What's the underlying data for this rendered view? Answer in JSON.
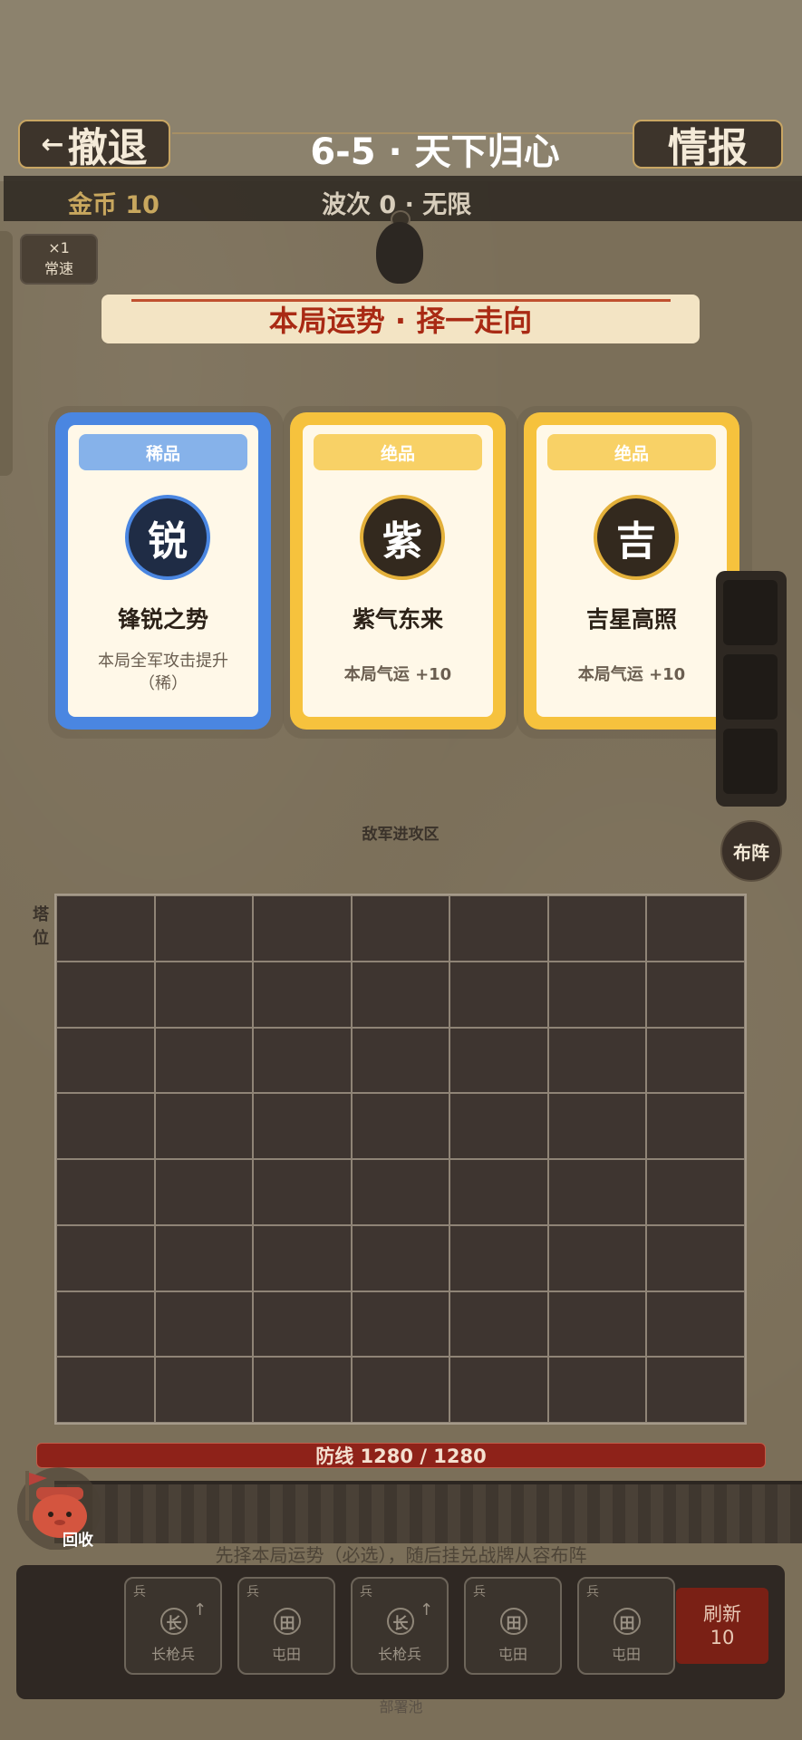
{
  "header": {
    "retreat_label": "撤退",
    "retreat_icon": "←",
    "title": "6-5 · 天下归心",
    "intel_label": "情报"
  },
  "status": {
    "gold": "金币 10",
    "wave": "波次 0 · 无限"
  },
  "speed": {
    "multiplier": "×1",
    "label": "常速"
  },
  "fortune": {
    "banner": "本局运势 · 择一走向",
    "cards": [
      {
        "rarity": "稀品",
        "emblem": "锐",
        "name": "锋锐之势",
        "desc": "本局全军攻击提升（稀）"
      },
      {
        "rarity": "绝品",
        "emblem": "紫",
        "name": "紫气东来",
        "desc": "本局气运 +10"
      },
      {
        "rarity": "绝品",
        "emblem": "吉",
        "name": "吉星高照",
        "desc": "本局气运 +10"
      }
    ]
  },
  "battlefield": {
    "enemy_zone": "敌军进攻区",
    "tower_label": "塔位",
    "deploy_label": "布阵",
    "defense": "防线 1280 / 1280",
    "defense_fraction": 1.0
  },
  "bottom": {
    "recycle_label": "回收",
    "hint": "先择本局运势（必选），随后挂兑战牌从容布阵",
    "hand": [
      {
        "kind": "兵",
        "icon": "长",
        "name": "长枪兵",
        "arrow": true
      },
      {
        "kind": "兵",
        "icon": "田",
        "name": "屯田",
        "arrow": false
      },
      {
        "kind": "兵",
        "icon": "长",
        "name": "长枪兵",
        "arrow": true
      },
      {
        "kind": "兵",
        "icon": "田",
        "name": "屯田",
        "arrow": false
      },
      {
        "kind": "兵",
        "icon": "田",
        "name": "屯田",
        "arrow": false
      }
    ],
    "refresh_label": "刷新",
    "refresh_cost": "10",
    "pool_label": "部署池"
  },
  "colors": {
    "rare": "#4a86e1",
    "epic": "#f6c23d",
    "defense_bar": "#8e2219",
    "banner_text": "#a92a14"
  }
}
